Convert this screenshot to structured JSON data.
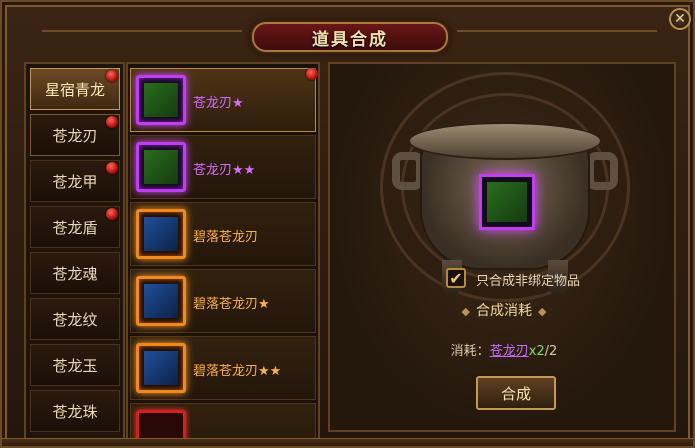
{
  "window": {
    "title": "道具合成",
    "close_label": "✕"
  },
  "categories": [
    {
      "label": "星宿青龙",
      "active": true,
      "badge": true
    },
    {
      "label": "苍龙刃",
      "active": false,
      "badge": true
    },
    {
      "label": "苍龙甲",
      "active": false,
      "badge": true
    },
    {
      "label": "苍龙盾",
      "active": false,
      "badge": true
    },
    {
      "label": "苍龙魂",
      "active": false,
      "badge": false
    },
    {
      "label": "苍龙纹",
      "active": false,
      "badge": false
    },
    {
      "label": "苍龙玉",
      "active": false,
      "badge": false
    },
    {
      "label": "苍龙珠",
      "active": false,
      "badge": false
    }
  ],
  "items": [
    {
      "name": "苍龙刃★",
      "quality": "purple",
      "badge": true
    },
    {
      "name": "苍龙刃★★",
      "quality": "purple",
      "badge": false
    },
    {
      "name": "碧落苍龙刃",
      "quality": "orange",
      "badge": false
    },
    {
      "name": "碧落苍龙刃★",
      "quality": "orange",
      "badge": false
    },
    {
      "name": "碧落苍龙刃★★",
      "quality": "orange",
      "badge": false
    }
  ],
  "craft": {
    "checkbox_label": "只合成非绑定物品",
    "checkbox_mark": "✔",
    "section_title": "合成消耗",
    "section_ornament": "◆",
    "cost_prefix": "消耗：",
    "cost_item": "苍龙刃",
    "cost_multiplier": "x2",
    "cost_progress": "/2",
    "button_label": "合成"
  },
  "colors": {
    "purple_quality": "#c03ef0",
    "orange_quality": "#f08a1c",
    "badge_red": "#d41a1a"
  }
}
